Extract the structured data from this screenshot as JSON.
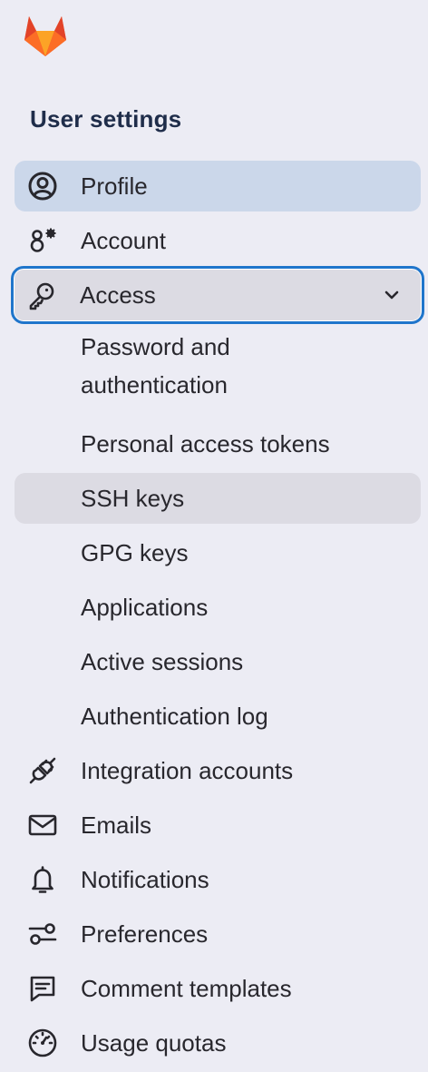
{
  "brand": {
    "logo_icon": "gitlab-tanuki-icon",
    "colors": {
      "orange_dark": "#e24329",
      "orange": "#fc6d26",
      "orange_light": "#fca326"
    }
  },
  "sidebar": {
    "section_title": "User settings",
    "items": [
      {
        "label": "Profile",
        "icon": "user-circle-icon",
        "state": "active"
      },
      {
        "label": "Account",
        "icon": "account-settings-icon"
      },
      {
        "label": "Access",
        "icon": "key-icon",
        "state": "expanded",
        "chevron": "chevron-down-icon"
      }
    ],
    "access_subitems": [
      {
        "label": "Password and authentication"
      },
      {
        "label": "Personal access tokens"
      },
      {
        "label": "SSH keys",
        "state": "selected"
      },
      {
        "label": "GPG keys"
      },
      {
        "label": "Applications"
      },
      {
        "label": "Active sessions"
      },
      {
        "label": "Authentication log"
      }
    ],
    "more_items": [
      {
        "label": "Integration accounts",
        "icon": "plug-icon"
      },
      {
        "label": "Emails",
        "icon": "mail-icon"
      },
      {
        "label": "Notifications",
        "icon": "bell-icon"
      },
      {
        "label": "Preferences",
        "icon": "preferences-icon"
      },
      {
        "label": "Comment templates",
        "icon": "comment-icon"
      },
      {
        "label": "Usage quotas",
        "icon": "gauge-icon"
      }
    ]
  },
  "colors": {
    "background": "#ececf4",
    "active_bg": "#cbd7ea",
    "selected_bg": "#dcdbe3",
    "focus_ring": "#1f75cb",
    "title_text": "#1f2d4a",
    "text": "#28272d"
  }
}
